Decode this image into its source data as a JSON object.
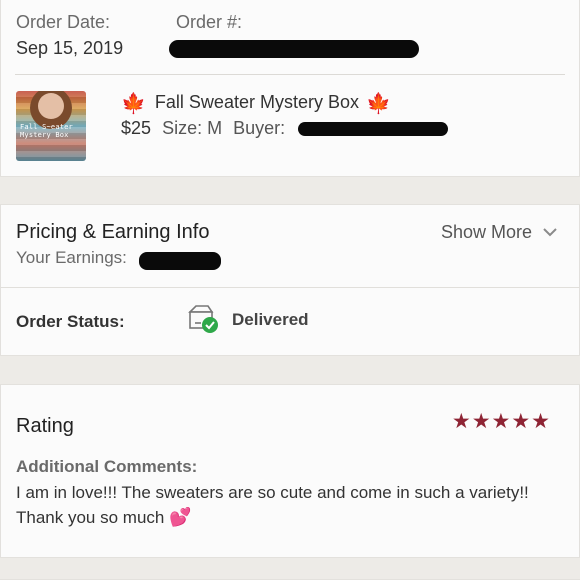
{
  "order": {
    "date_label": "Order Date:",
    "date_value": "Sep 15, 2019",
    "number_label": "Order #:"
  },
  "item": {
    "thumbnail_text": "Fall Sweater\nMystery Box",
    "title": "Fall Sweater Mystery Box",
    "title_emoji": "🍁",
    "price": "$25",
    "size_label": "Size: M",
    "buyer_label": "Buyer:"
  },
  "pricing": {
    "title": "Pricing & Earning Info",
    "earnings_label": "Your Earnings:",
    "show_more": "Show More"
  },
  "status": {
    "label": "Order Status:",
    "value": "Delivered"
  },
  "rating": {
    "title": "Rating",
    "stars": 5,
    "max_stars": 5,
    "comments_label": "Additional Comments:",
    "comment_text": "I am in love!!! The sweaters are so cute and come in such a variety!! Thank you so much",
    "comment_emoji": "💕"
  },
  "colors": {
    "star": "#8e2434",
    "delivered_check": "#2fa84a",
    "leaf": "#d4521c"
  },
  "icons": [
    "maple-leaf-icon",
    "chevron-down-icon",
    "package-delivered-icon",
    "star-icon",
    "two-hearts-icon"
  ]
}
